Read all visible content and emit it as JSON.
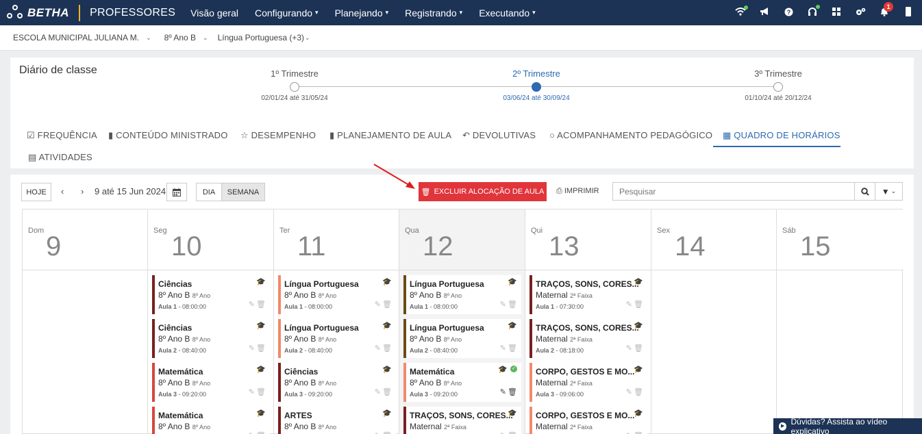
{
  "app": {
    "brand": "BETHA",
    "module": "PROFESSORES"
  },
  "menu": [
    {
      "label": "Visão geral",
      "dropdown": false
    },
    {
      "label": "Configurando",
      "dropdown": true
    },
    {
      "label": "Planejando",
      "dropdown": true
    },
    {
      "label": "Registrando",
      "dropdown": true
    },
    {
      "label": "Executando",
      "dropdown": true
    }
  ],
  "top_icons": [
    "wifi-icon",
    "megaphone-icon",
    "help-icon",
    "headset-icon",
    "apps-grid-icon",
    "settings-icon",
    "bell-icon",
    "user-icon"
  ],
  "notifications": {
    "count": "1"
  },
  "context": {
    "school": "ESCOLA MUNICIPAL JULIANA M.",
    "class": "8º Ano B",
    "subject": "Língua Portuguesa (+3)"
  },
  "diario": {
    "title": "Diário de classe"
  },
  "trimesters": [
    {
      "label": "1º Trimestre",
      "dates": "02/01/24 até 31/05/24",
      "active": false
    },
    {
      "label": "2º Trimestre",
      "dates": "03/06/24 até 30/09/24",
      "active": true
    },
    {
      "label": "3º Trimestre",
      "dates": "01/10/24 até 20/12/24",
      "active": false
    }
  ],
  "tabs": [
    {
      "label": "FREQUÊNCIA",
      "icon": "checkbox-icon"
    },
    {
      "label": "CONTEÚDO MINISTRADO",
      "icon": "book-icon"
    },
    {
      "label": "DESEMPENHO",
      "icon": "star-icon"
    },
    {
      "label": "PLANEJAMENTO DE AULA",
      "icon": "book-icon"
    },
    {
      "label": "DEVOLUTIVAS",
      "icon": "reply-icon"
    },
    {
      "label": "ACOMPANHAMENTO PEDAGÓGICO",
      "icon": "comment-icon"
    },
    {
      "label": "QUADRO DE HORÁRIOS",
      "icon": "calendar-icon",
      "active": true
    },
    {
      "label": "ATIVIDADES",
      "icon": "document-icon"
    }
  ],
  "toolbar": {
    "today": "HOJE",
    "range": "9 até 15 Jun 2024",
    "view_day": "DIA",
    "view_week": "SEMANA",
    "delete": "EXCLUIR ALOCAÇÃO DE AULA",
    "print": "IMPRIMIR",
    "search_placeholder": "Pesquisar"
  },
  "days": [
    {
      "name": "Dom",
      "num": "9"
    },
    {
      "name": "Seg",
      "num": "10"
    },
    {
      "name": "Ter",
      "num": "11"
    },
    {
      "name": "Qua",
      "num": "12",
      "today": true
    },
    {
      "name": "Qui",
      "num": "13"
    },
    {
      "name": "Sex",
      "num": "14"
    },
    {
      "name": "Sáb",
      "num": "15"
    }
  ],
  "events": [
    [],
    [
      {
        "title": "Ciências",
        "class": "8º Ano B",
        "sub": "8º Ano",
        "aula": "Aula 1",
        "time": "08:00:00",
        "color": "#7a1f1f"
      },
      {
        "title": "Ciências",
        "class": "8º Ano B",
        "sub": "8º Ano",
        "aula": "Aula 2",
        "time": "08:40:00",
        "color": "#7a1f1f"
      },
      {
        "title": "Matemática",
        "class": "8º Ano B",
        "sub": "8º Ano",
        "aula": "Aula 3",
        "time": "09:20:00",
        "color": "#d9463f"
      },
      {
        "title": "Matemática",
        "class": "8º Ano B",
        "sub": "8º Ano",
        "aula": "",
        "time": "",
        "color": "#d9463f"
      }
    ],
    [
      {
        "title": "Língua Portuguesa",
        "class": "8º Ano B",
        "sub": "8º Ano",
        "aula": "Aula 1",
        "time": "08:00:00",
        "color": "#f08a6c"
      },
      {
        "title": "Língua Portuguesa",
        "class": "8º Ano B",
        "sub": "8º Ano",
        "aula": "Aula 2",
        "time": "08:40:00",
        "color": "#f08a6c"
      },
      {
        "title": "Ciências",
        "class": "8º Ano B",
        "sub": "8º Ano",
        "aula": "Aula 3",
        "time": "09:20:00",
        "color": "#7a1f1f"
      },
      {
        "title": "ARTES",
        "class": "8º Ano B",
        "sub": "8º Ano",
        "aula": "",
        "time": "",
        "color": "#7a1f1f"
      }
    ],
    [
      {
        "title": "Língua Portuguesa",
        "class": "8º Ano B",
        "sub": "8º Ano",
        "aula": "Aula 1",
        "time": "08:00:00",
        "color": "#6b4a12"
      },
      {
        "title": "Língua Portuguesa",
        "class": "8º Ano B",
        "sub": "8º Ano",
        "aula": "Aula 2",
        "time": "08:40:00",
        "color": "#6b4a12"
      },
      {
        "title": "Matemática",
        "class": "8º Ano B",
        "sub": "8º Ano",
        "aula": "Aula 3",
        "time": "09:20:00",
        "color": "#f08a6c",
        "selected": true
      },
      {
        "title": "TRAÇOS, SONS, CORES...",
        "class": "Maternal",
        "sub": "2ª Faixa",
        "aula": "",
        "time": "",
        "color": "#7a1f1f"
      }
    ],
    [
      {
        "title": "TRAÇOS, SONS, CORES...",
        "class": "Maternal",
        "sub": "2ª Faixa",
        "aula": "Aula 1",
        "time": "07:30:00",
        "color": "#7a1f1f"
      },
      {
        "title": "TRAÇOS, SONS, CORES...",
        "class": "Maternal",
        "sub": "2ª Faixa",
        "aula": "Aula 2",
        "time": "08:18:00",
        "color": "#7a1f1f"
      },
      {
        "title": "CORPO, GESTOS E MO...",
        "class": "Maternal",
        "sub": "2ª Faixa",
        "aula": "Aula 3",
        "time": "09:06:00",
        "color": "#f08a6c"
      },
      {
        "title": "CORPO, GESTOS E MO...",
        "class": "Maternal",
        "sub": "2ª Faixa",
        "aula": "",
        "time": "",
        "color": "#f08a6c"
      }
    ],
    [],
    []
  ],
  "help": {
    "label": "Dúvidas? Assista ao vídeo explicativo"
  }
}
